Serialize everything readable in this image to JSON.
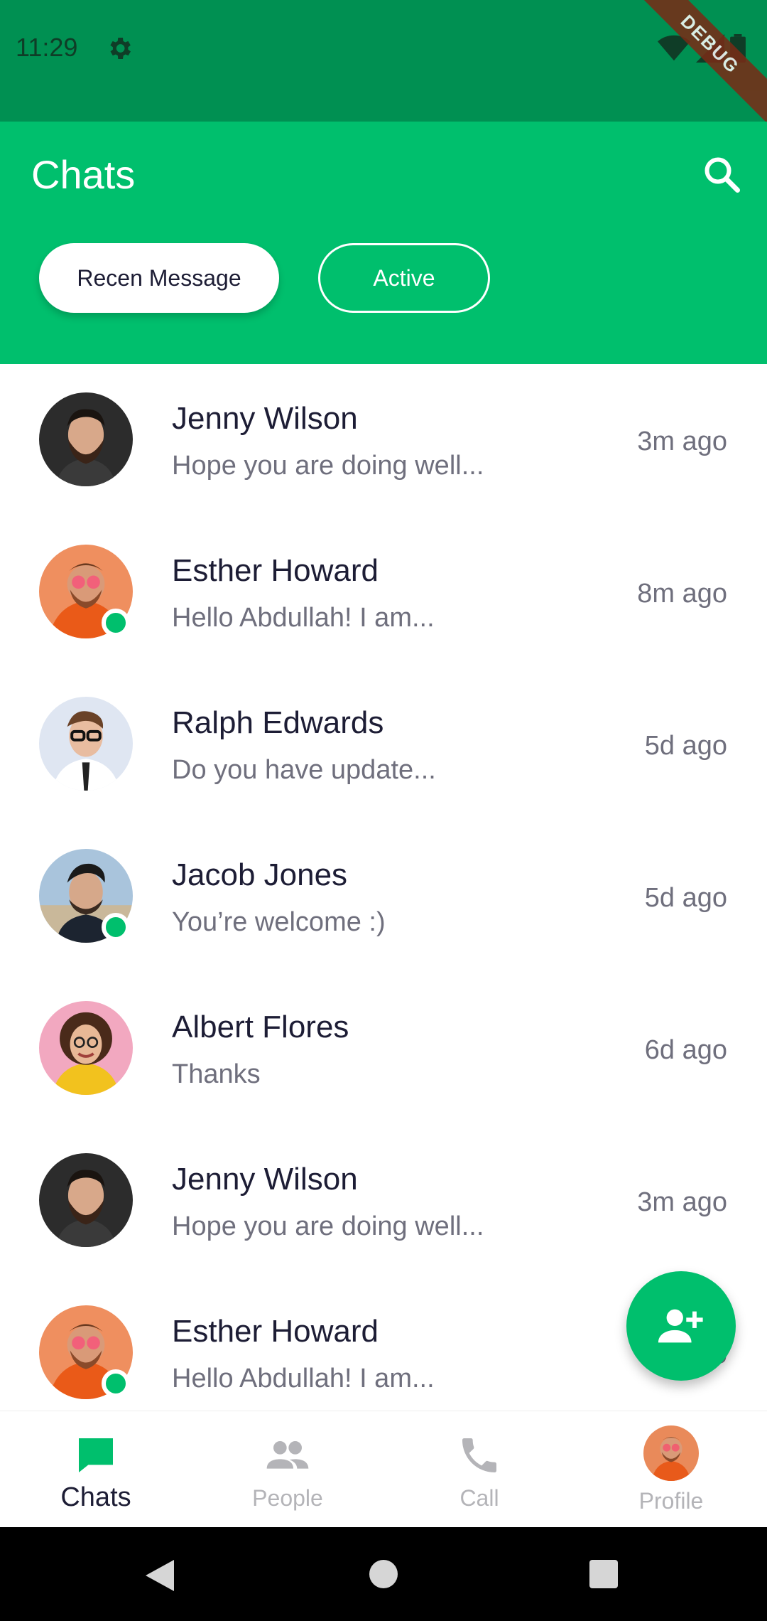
{
  "status": {
    "time": "11:29",
    "debug_label": "DEBUG"
  },
  "header": {
    "title": "Chats"
  },
  "filters": {
    "recent_label": "Recen Message",
    "active_label": "Active"
  },
  "chats": [
    {
      "name": "Jenny Wilson",
      "message": "Hope you are doing well...",
      "time": "3m ago",
      "online": false,
      "avatar": "bearded-dark"
    },
    {
      "name": "Esther Howard",
      "message": "Hello Abdullah! I am...",
      "time": "8m ago",
      "online": true,
      "avatar": "orange-hoodie"
    },
    {
      "name": "Ralph Edwards",
      "message": "Do you have update...",
      "time": "5d ago",
      "online": false,
      "avatar": "glasses-suit"
    },
    {
      "name": "Jacob Jones",
      "message": "You’re welcome :)",
      "time": "5d ago",
      "online": true,
      "avatar": "stylish-hair"
    },
    {
      "name": "Albert Flores",
      "message": "Thanks",
      "time": "6d ago",
      "online": false,
      "avatar": "curly-yellow"
    },
    {
      "name": "Jenny Wilson",
      "message": "Hope you are doing well...",
      "time": "3m ago",
      "online": false,
      "avatar": "bearded-dark"
    },
    {
      "name": "Esther Howard",
      "message": "Hello Abdullah! I am...",
      "time": "8m ago",
      "online": true,
      "avatar": "orange-hoodie"
    }
  ],
  "bottom_nav": {
    "chats": "Chats",
    "people": "People",
    "call": "Call",
    "profile": "Profile"
  },
  "colors": {
    "primary": "#00bf6d",
    "status_bar": "#009052",
    "text_dark": "#1d1d35",
    "text_muted": "#6f6f7d"
  }
}
